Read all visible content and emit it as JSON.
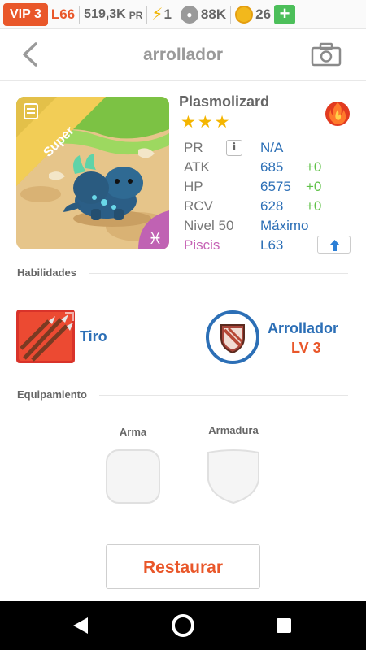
{
  "statusbar": {
    "vip": "VIP 3",
    "level": "L66",
    "pr_value": "519,3K",
    "pr_unit": "PR",
    "energy": "1",
    "paw_value": "88K",
    "coins": "26",
    "plus": "+"
  },
  "header": {
    "title": "arrollador",
    "back_icon": "chevron-left-icon",
    "camera_icon": "camera-icon"
  },
  "monster": {
    "name": "Plasmolizard",
    "stars": "★★★",
    "rank_badge": "Super",
    "element_icon": "fire-icon",
    "zodiac_icon": "pisces-icon"
  },
  "stats": {
    "pr_label": "PR",
    "pr_value": "N/A",
    "atk_label": "ATK",
    "atk_value": "685",
    "atk_bonus": "+0",
    "hp_label": "HP",
    "hp_value": "6575",
    "hp_bonus": "+0",
    "rcv_label": "RCV",
    "rcv_value": "628",
    "rcv_bonus": "+0",
    "level_label": "Nivel 50",
    "level_value": "Máximo",
    "sign_label": "Piscis",
    "sign_value": "L63"
  },
  "skills": {
    "title": "Habilidades",
    "skill1_name": "Tiro",
    "skill2_name": "Arrollador",
    "skill2_level": "LV 3"
  },
  "equipment": {
    "title": "Equipamiento",
    "weapon_label": "Arma",
    "armor_label": "Armadura"
  },
  "actions": {
    "restore_label": "Restaurar"
  },
  "colors": {
    "accent": "#e9572a",
    "link": "#2c6fb6",
    "bonus": "#61c24a",
    "star": "#f4b500"
  }
}
